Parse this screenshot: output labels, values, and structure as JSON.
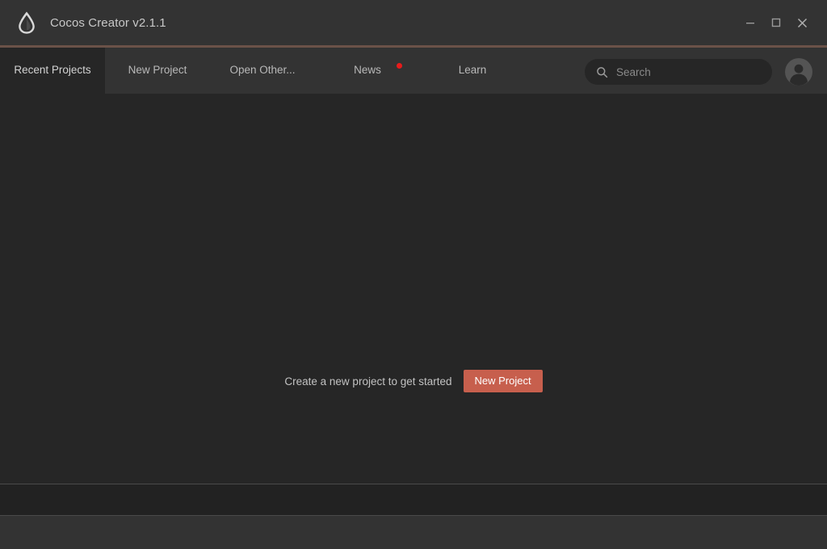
{
  "window": {
    "title": "Cocos Creator v2.1.1",
    "logo_icon": "water-drop-logo-icon",
    "controls": {
      "minimize": "minimize-icon",
      "maximize": "maximize-icon",
      "close": "close-icon"
    }
  },
  "colors": {
    "titlebar_bg": "#333333",
    "content_bg": "#262626",
    "accent_rule": "#6b5248",
    "accent_button": "#c75f4d",
    "badge_red": "#e81b1b",
    "footer_strip_bg": "#222222",
    "divider": "#4a4a4a",
    "text_primary": "#c8c8c8",
    "text_muted": "#8a8a8a"
  },
  "tabs": [
    {
      "label": "Recent Projects",
      "active": true,
      "badge": false
    },
    {
      "label": "New Project",
      "active": false,
      "badge": false
    },
    {
      "label": "Open Other...",
      "active": false,
      "badge": false
    },
    {
      "label": "News",
      "active": false,
      "badge": true
    },
    {
      "label": "Learn",
      "active": false,
      "badge": false
    }
  ],
  "search": {
    "placeholder": "Search",
    "value": "",
    "icon": "search-icon"
  },
  "account": {
    "avatar_icon": "user-avatar-icon"
  },
  "main": {
    "empty_state": {
      "message": "Create a new project to get started",
      "button_label": "New Project"
    }
  }
}
